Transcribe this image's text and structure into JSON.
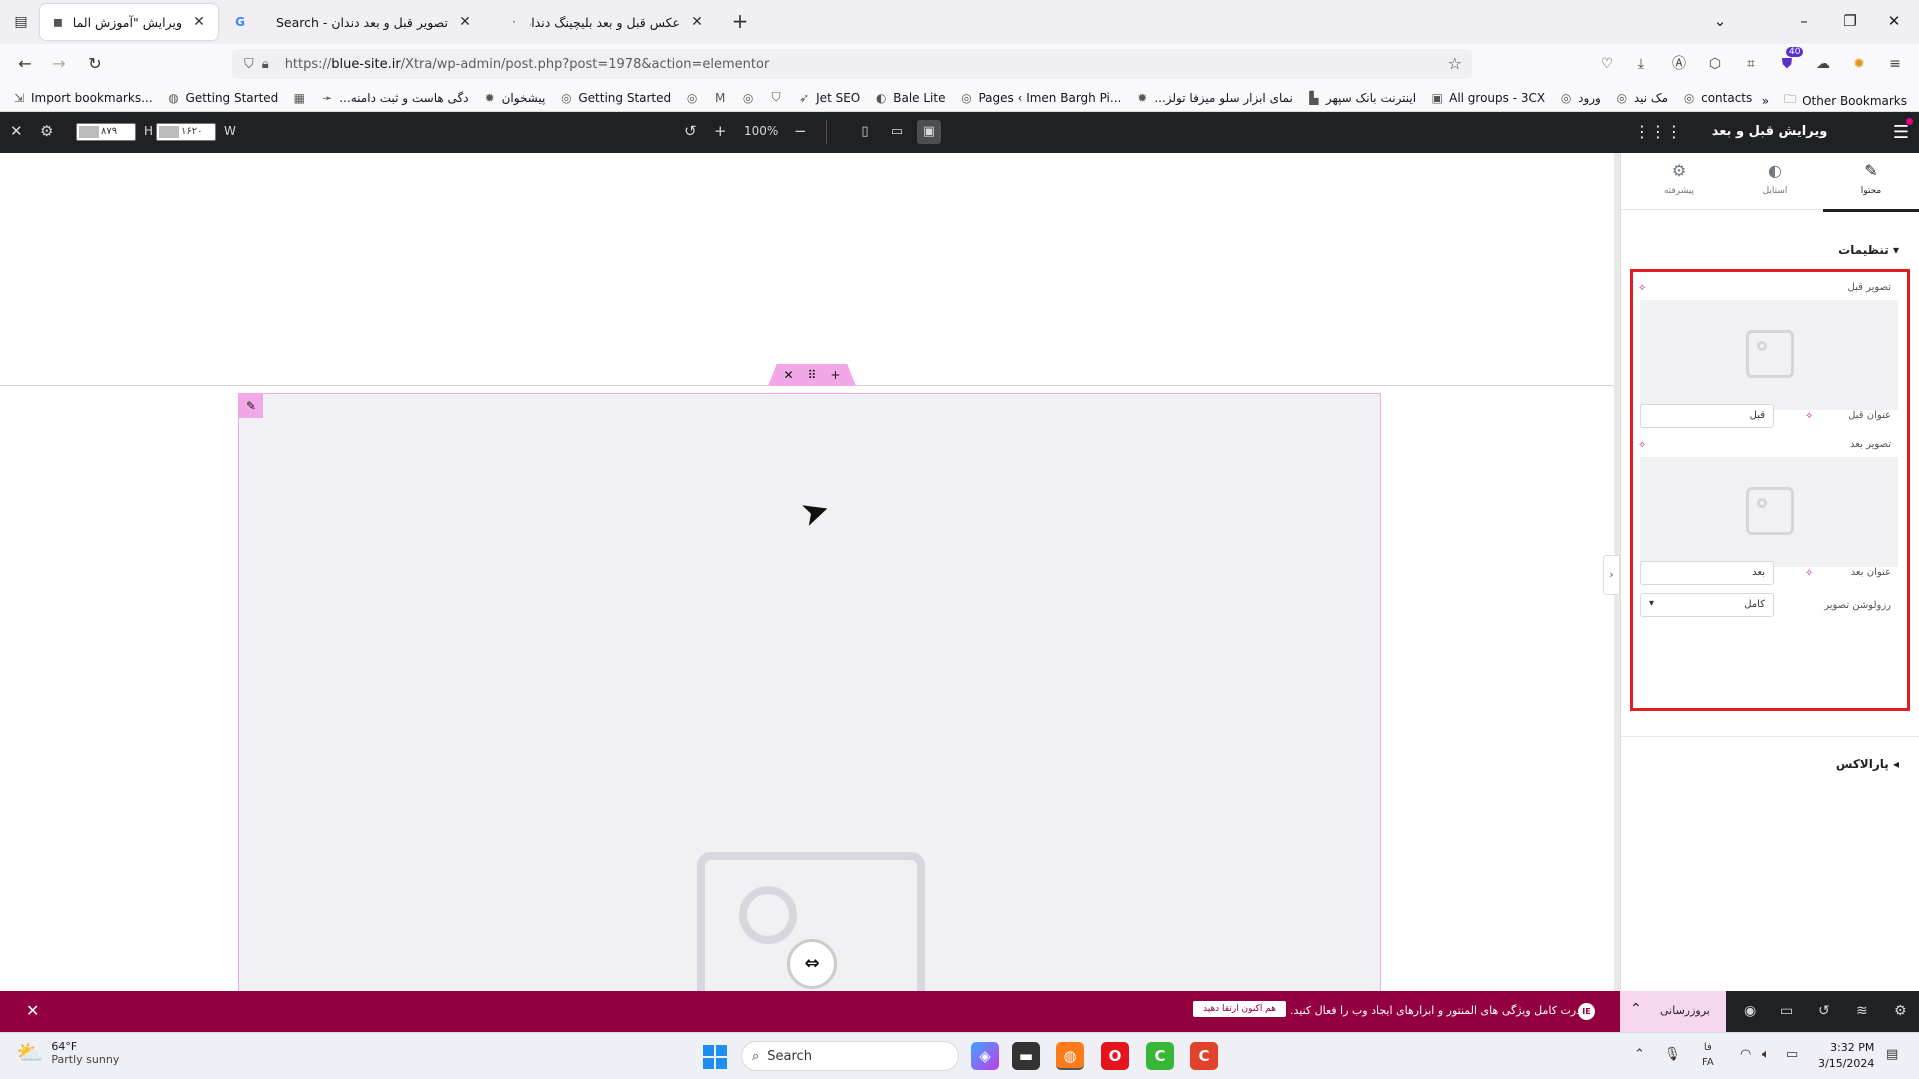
{
  "browser": {
    "tabs": [
      {
        "title": "ویرایش \"آموزش المان های اکسترا – م",
        "active": true,
        "favicon": "elementor-icon"
      },
      {
        "title": "تصویر قبل و بعد دندان - Search",
        "active": false,
        "favicon": "google-icon"
      },
      {
        "title": "عکس قبل و بعد بلیچینگ دندان",
        "active": false,
        "favicon": "page-icon"
      }
    ],
    "url_prefix": "https://",
    "url_domain": "blue-site.ir",
    "url_path": "/Xtra/wp-admin/post.php?post=1978&action=elementor",
    "extension_badge": "40",
    "bookmarks": [
      {
        "label": "Import bookmarks...",
        "icon": "import-icon"
      },
      {
        "label": "Getting Started",
        "icon": "firefox-icon"
      },
      {
        "label": "",
        "icon": "calendar-icon"
      },
      {
        "label": "...دگی هاست و ثبت دامنه",
        "icon": "arrow-icon"
      },
      {
        "label": "پیشخوان",
        "icon": "gear-icon"
      },
      {
        "label": "Getting Started",
        "icon": "globe-icon"
      },
      {
        "label": "",
        "icon": "globe-icon"
      },
      {
        "label": "",
        "icon": "gmail-icon"
      },
      {
        "label": "",
        "icon": "globe-icon"
      },
      {
        "label": "",
        "icon": "shield-icon"
      },
      {
        "label": "Jet SEO",
        "icon": "rocket-icon"
      },
      {
        "label": "Bale Lite",
        "icon": "bale-icon"
      },
      {
        "label": "Pages ‹ Imen Bargh Pi...",
        "icon": "globe-icon"
      },
      {
        "label": "...نمای ابزار سلو میزفا تولز",
        "icon": "gear-icon"
      },
      {
        "label": "اینترنت بانک سپهر",
        "icon": "bank-icon"
      },
      {
        "label": "All groups - 3CX",
        "icon": "3cx-icon"
      },
      {
        "label": "ورود",
        "icon": "globe-icon"
      },
      {
        "label": "مک نید",
        "icon": "globe-icon"
      },
      {
        "label": "contacts",
        "icon": "globe-icon"
      }
    ],
    "other_bookmarks": "Other Bookmarks"
  },
  "editor_top": {
    "height_value": "۸۷۹",
    "height_label": "H",
    "width_value": "۱۶۲۰",
    "width_label": "W",
    "zoom": "100%"
  },
  "panel": {
    "title": "ویرایش قبل و بعد",
    "tabs": [
      {
        "label": "محتوا",
        "icon": "pencil-icon",
        "active": true
      },
      {
        "label": "استایل",
        "icon": "contrast-icon",
        "active": false
      },
      {
        "label": "پیشرفته",
        "icon": "gear-icon",
        "active": false
      }
    ],
    "section_settings": "تنظیمات",
    "before_image_label": "تصویر قبل",
    "before_title_label": "عنوان قبل",
    "before_title_value": "قبل",
    "after_image_label": "تصویر بعد",
    "after_title_label": "عنوان بعد",
    "after_title_value": "بعد",
    "resolution_label": "رزولوشن تصویر",
    "resolution_value": "کامل",
    "section_parallax": "پارالاکس",
    "publish_label": "بروزرسانی"
  },
  "notice": {
    "message": "قدرت کامل ویژگی های المنتور و ابزارهای ایجاد وب را فعال کنید.",
    "button": "هم اکنون ارتقا دهید",
    "brand": "IE"
  },
  "taskbar": {
    "temperature": "64°F",
    "weather": "Partly sunny",
    "search_placeholder": "Search",
    "lang_top": "فا",
    "lang_bottom": "FA",
    "time": "3:32 PM",
    "date": "3/15/2024"
  },
  "colors": {
    "accent_pink": "#f2a7e6",
    "notice_bg": "#93003f",
    "highlight_red": "#e21b23",
    "editor_dark": "#1f2124"
  }
}
